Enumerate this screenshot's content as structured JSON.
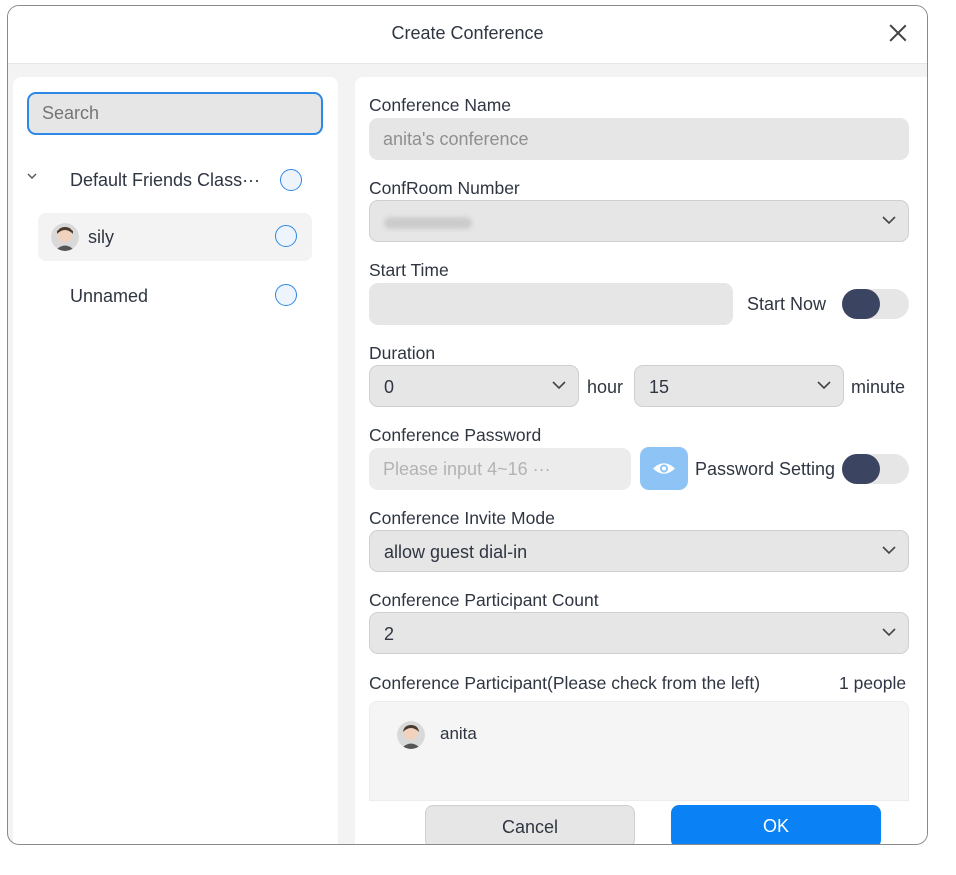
{
  "dialog": {
    "title": "Create Conference"
  },
  "left": {
    "search_placeholder": "Search",
    "group": {
      "label": "Default Friends Class···"
    },
    "items": [
      {
        "label": "sily",
        "selected": true
      },
      {
        "label": "Unnamed",
        "selected": false
      }
    ]
  },
  "form": {
    "conference_name": {
      "label": "Conference Name",
      "value": "anita's conference"
    },
    "room_number": {
      "label": "ConfRoom Number",
      "value": ""
    },
    "start_time": {
      "label": "Start Time",
      "value": "",
      "start_now_label": "Start Now"
    },
    "duration": {
      "label": "Duration",
      "hours": "0",
      "hour_unit": "hour",
      "minutes": "15",
      "minute_unit": "minute"
    },
    "password": {
      "label": "Conference Password",
      "placeholder": "Please input 4~16 ···",
      "setting_label": "Password Setting"
    },
    "invite_mode": {
      "label": "Conference Invite Mode",
      "value": "allow guest dial-in"
    },
    "participant_count": {
      "label": "Conference Participant Count",
      "value": "2"
    },
    "participants": {
      "label": "Conference Participant(Please check from the left)",
      "count": "1 people",
      "list": [
        {
          "name": "anita"
        }
      ]
    }
  },
  "buttons": {
    "cancel": "Cancel",
    "ok": "OK"
  },
  "colors": {
    "accent": "#0a82f6",
    "toggle_knob": "#3b4460",
    "focus_border": "#2d88e6"
  }
}
